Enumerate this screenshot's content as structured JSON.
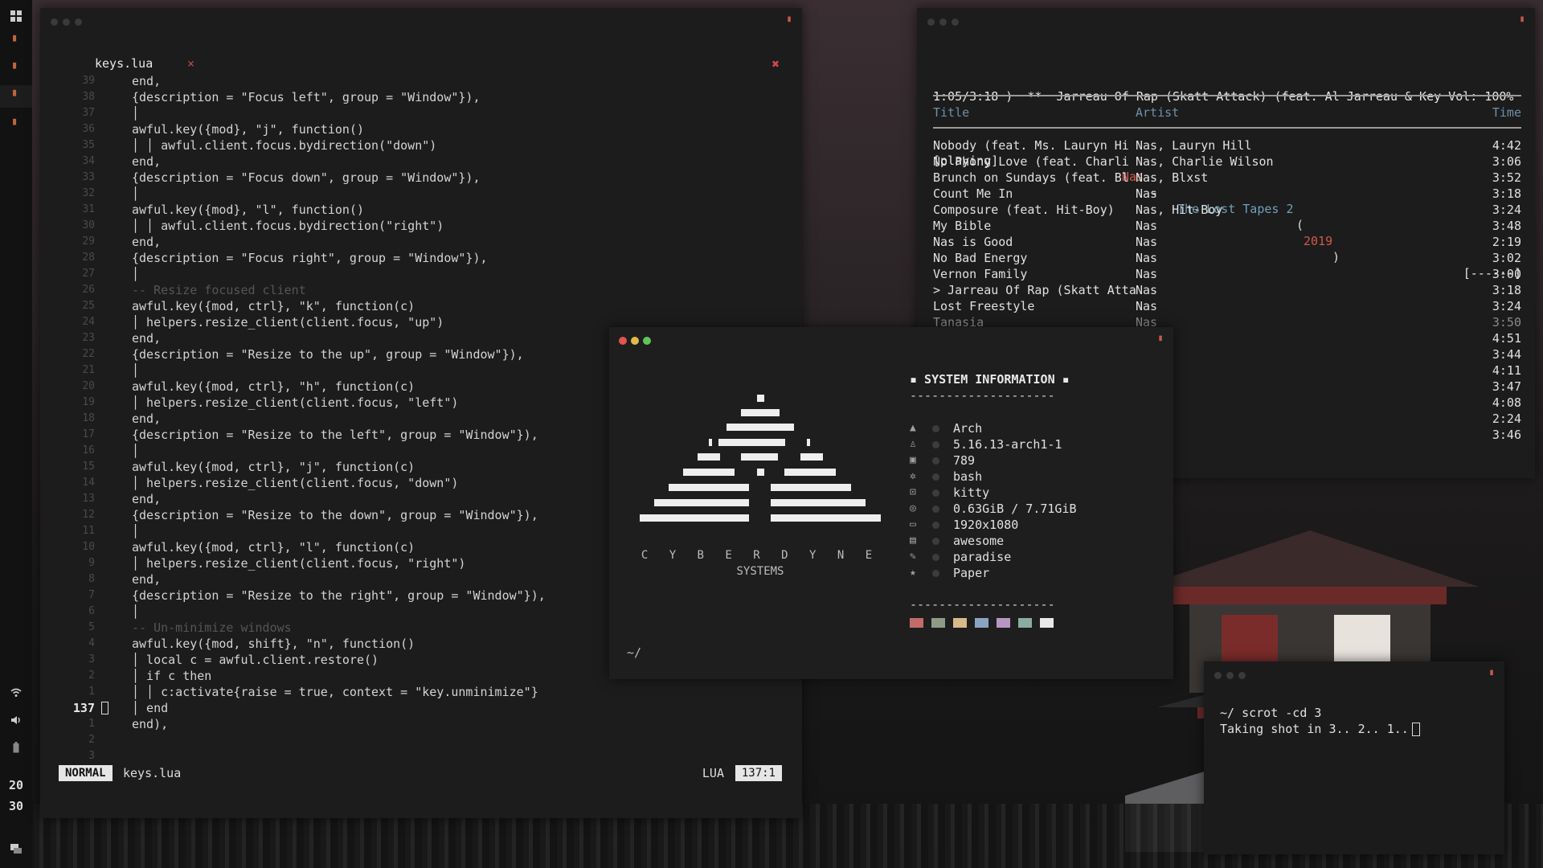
{
  "sidebar": {
    "icons": [
      "grid-icon",
      "app-icon",
      "app-icon",
      "app-icon",
      "app-icon"
    ],
    "status_icons": [
      "wifi-icon",
      "volume-icon",
      "battery-icon"
    ],
    "clock_hour": "20",
    "clock_minute": "30"
  },
  "editor": {
    "tab_label": "keys.lua",
    "tab_close": "×",
    "close_glyph": "✖",
    "cursor_line": "137",
    "lines": [
      {
        "n": "39",
        "t": "end,",
        "indent": 0
      },
      {
        "n": "38",
        "t": "{description = \"Focus left\", group = \"Window\"}),",
        "indent": 0
      },
      {
        "n": "37",
        "t": "│",
        "indent": 0
      },
      {
        "n": "36",
        "t": "awful.key({mod}, \"j\", function()",
        "indent": 0
      },
      {
        "n": "35",
        "t": "│ │ awful.client.focus.bydirection(\"down\")",
        "indent": 0
      },
      {
        "n": "34",
        "t": "end,",
        "indent": 0
      },
      {
        "n": "33",
        "t": "{description = \"Focus down\", group = \"Window\"}),",
        "indent": 0
      },
      {
        "n": "32",
        "t": "│",
        "indent": 0
      },
      {
        "n": "31",
        "t": "awful.key({mod}, \"l\", function()",
        "indent": 0
      },
      {
        "n": "30",
        "t": "│ │ awful.client.focus.bydirection(\"right\")",
        "indent": 0
      },
      {
        "n": "29",
        "t": "end,",
        "indent": 0
      },
      {
        "n": "28",
        "t": "{description = \"Focus right\", group = \"Window\"}),",
        "indent": 0
      },
      {
        "n": "27",
        "t": "│",
        "indent": 0
      },
      {
        "n": "26",
        "t": "-- Resize focused client",
        "indent": 0,
        "comment": true
      },
      {
        "n": "25",
        "t": "awful.key({mod, ctrl}, \"k\", function(c)",
        "indent": 0
      },
      {
        "n": "24",
        "t": "│ helpers.resize_client(client.focus, \"up\")",
        "indent": 0
      },
      {
        "n": "23",
        "t": "end,",
        "indent": 0
      },
      {
        "n": "22",
        "t": "{description = \"Resize to the up\", group = \"Window\"}),",
        "indent": 0
      },
      {
        "n": "21",
        "t": "│",
        "indent": 0
      },
      {
        "n": "20",
        "t": "awful.key({mod, ctrl}, \"h\", function(c)",
        "indent": 0
      },
      {
        "n": "19",
        "t": "│ helpers.resize_client(client.focus, \"left\")",
        "indent": 0
      },
      {
        "n": "18",
        "t": "end,",
        "indent": 0
      },
      {
        "n": "17",
        "t": "{description = \"Resize to the left\", group = \"Window\"}),",
        "indent": 0
      },
      {
        "n": "16",
        "t": "│",
        "indent": 0
      },
      {
        "n": "15",
        "t": "awful.key({mod, ctrl}, \"j\", function(c)",
        "indent": 0
      },
      {
        "n": "14",
        "t": "│ helpers.resize_client(client.focus, \"down\")",
        "indent": 0
      },
      {
        "n": "13",
        "t": "end,",
        "indent": 0
      },
      {
        "n": "12",
        "t": "{description = \"Resize to the down\", group = \"Window\"}),",
        "indent": 0
      },
      {
        "n": "11",
        "t": "│",
        "indent": 0
      },
      {
        "n": "10",
        "t": "awful.key({mod, ctrl}, \"l\", function(c)",
        "indent": 0
      },
      {
        "n": "9",
        "t": "│ helpers.resize_client(client.focus, \"right\")",
        "indent": 0
      },
      {
        "n": "8",
        "t": "end,",
        "indent": 0
      },
      {
        "n": "7",
        "t": "{description = \"Resize to the right\", group = \"Window\"}),",
        "indent": 0
      },
      {
        "n": "6",
        "t": "│",
        "indent": 0
      },
      {
        "n": "5",
        "t": "-- Un-minimize windows",
        "indent": 0,
        "comment": true
      },
      {
        "n": "4",
        "t": "awful.key({mod, shift}, \"n\", function()",
        "indent": 0
      },
      {
        "n": "3",
        "t": "│ local c = awful.client.restore()",
        "indent": 0
      },
      {
        "n": "2",
        "t": "│ if c then",
        "indent": 0
      },
      {
        "n": "1",
        "t": "│ │ c:activate{raise = true, context = \"key.unminimize\"}",
        "indent": 0
      },
      {
        "n": "137",
        "t": "│ end",
        "indent": 0,
        "current": true
      },
      {
        "n": "1",
        "t": "end),",
        "indent": 0
      },
      {
        "n": "2",
        "t": "",
        "indent": 0
      },
      {
        "n": "3",
        "t": "",
        "indent": 0
      }
    ],
    "status": {
      "mode": "NORMAL",
      "file": "keys.lua",
      "lang": "LUA",
      "pos": "137:1"
    }
  },
  "music": {
    "line1": "1:05/3:18 )  **  Jarreau Of Rap (Skatt Attack) (feat. Al Jarreau & Key Vol: 100%",
    "line2_state": "[playing]",
    "line2_artist": "Nas",
    "line2_sep": " - ",
    "line2_album": "The Lost Tapes 2",
    "line2_year": "2019",
    "line2_bar": "[------]",
    "col_title": "Title",
    "col_artist": "Artist",
    "col_time": "Time",
    "tracks": [
      {
        "title": "Nobody (feat. Ms. Lauryn Hi",
        "artist": "Nas, Lauryn Hill",
        "time": "4:42"
      },
      {
        "title": "No Phony Love (feat. Charli",
        "artist": "Nas, Charlie Wilson",
        "time": "3:06"
      },
      {
        "title": "Brunch on Sundays (feat. Bl",
        "artist": "Nas, Blxst",
        "time": "3:52"
      },
      {
        "title": "Count Me In",
        "artist": "Nas",
        "time": "3:18"
      },
      {
        "title": "Composure (feat. Hit-Boy)",
        "artist": "Nas, Hit-Boy",
        "time": "3:24"
      },
      {
        "title": "My Bible",
        "artist": "Nas",
        "time": "3:48"
      },
      {
        "title": "Nas is Good",
        "artist": "Nas",
        "time": "2:19"
      },
      {
        "title": "No Bad Energy",
        "artist": "Nas",
        "time": "3:02"
      },
      {
        "title": "Vernon Family",
        "artist": "Nas",
        "time": "3:00"
      },
      {
        "title": "> Jarreau Of Rap (Skatt Atta",
        "artist": "Nas",
        "time": "3:18"
      },
      {
        "title": "Lost Freestyle",
        "artist": "Nas",
        "time": "3:24"
      },
      {
        "title": "Tanasia",
        "artist": "Nas",
        "time": "3:50"
      },
      {
        "title": "",
        "artist": "",
        "time": "4:51"
      },
      {
        "title": "",
        "artist": "",
        "time": "3:44"
      },
      {
        "title": "",
        "artist": "",
        "time": "4:11"
      },
      {
        "title": "",
        "artist": "",
        "time": "3:47"
      },
      {
        "title": "",
        "artist": "",
        "time": "4:08"
      },
      {
        "title": "",
        "artist": "",
        "time": "2:24"
      },
      {
        "title": "",
        "artist": "",
        "time": "3:46"
      }
    ]
  },
  "neofetch": {
    "logo_line1": "C Y B E R D Y N E",
    "logo_line2": "SYSTEMS",
    "title": "▪ SYSTEM INFORMATION ▪",
    "dashes": "--------------------",
    "info": [
      {
        "icon": "arch-icon",
        "glyph": "▲",
        "value": "Arch"
      },
      {
        "icon": "kernel-icon",
        "glyph": "♙",
        "value": "5.16.13-arch1-1"
      },
      {
        "icon": "package-icon",
        "glyph": "▣",
        "value": "789"
      },
      {
        "icon": "shell-icon",
        "glyph": "✲",
        "value": "bash"
      },
      {
        "icon": "terminal-icon",
        "glyph": "⊡",
        "value": "kitty"
      },
      {
        "icon": "memory-icon",
        "glyph": "◎",
        "value": "0.63GiB / 7.71GiB"
      },
      {
        "icon": "display-icon",
        "glyph": "▭",
        "value": "1920x1080"
      },
      {
        "icon": "window-manager-icon",
        "glyph": "▤",
        "value": "awesome"
      },
      {
        "icon": "brush-icon",
        "glyph": "✎",
        "value": "paradise"
      },
      {
        "icon": "star-icon",
        "glyph": "★",
        "value": "Paper"
      }
    ],
    "palette": [
      "#c26b6b",
      "#8f9a86",
      "#d8b98a",
      "#8ba4c4",
      "#b896c4",
      "#8aaca3",
      "#e8e8e8"
    ],
    "prompt": "~/"
  },
  "terminal": {
    "line1": "~/ scrot -cd 3",
    "line2": "Taking shot in 3.. 2.. 1.."
  }
}
